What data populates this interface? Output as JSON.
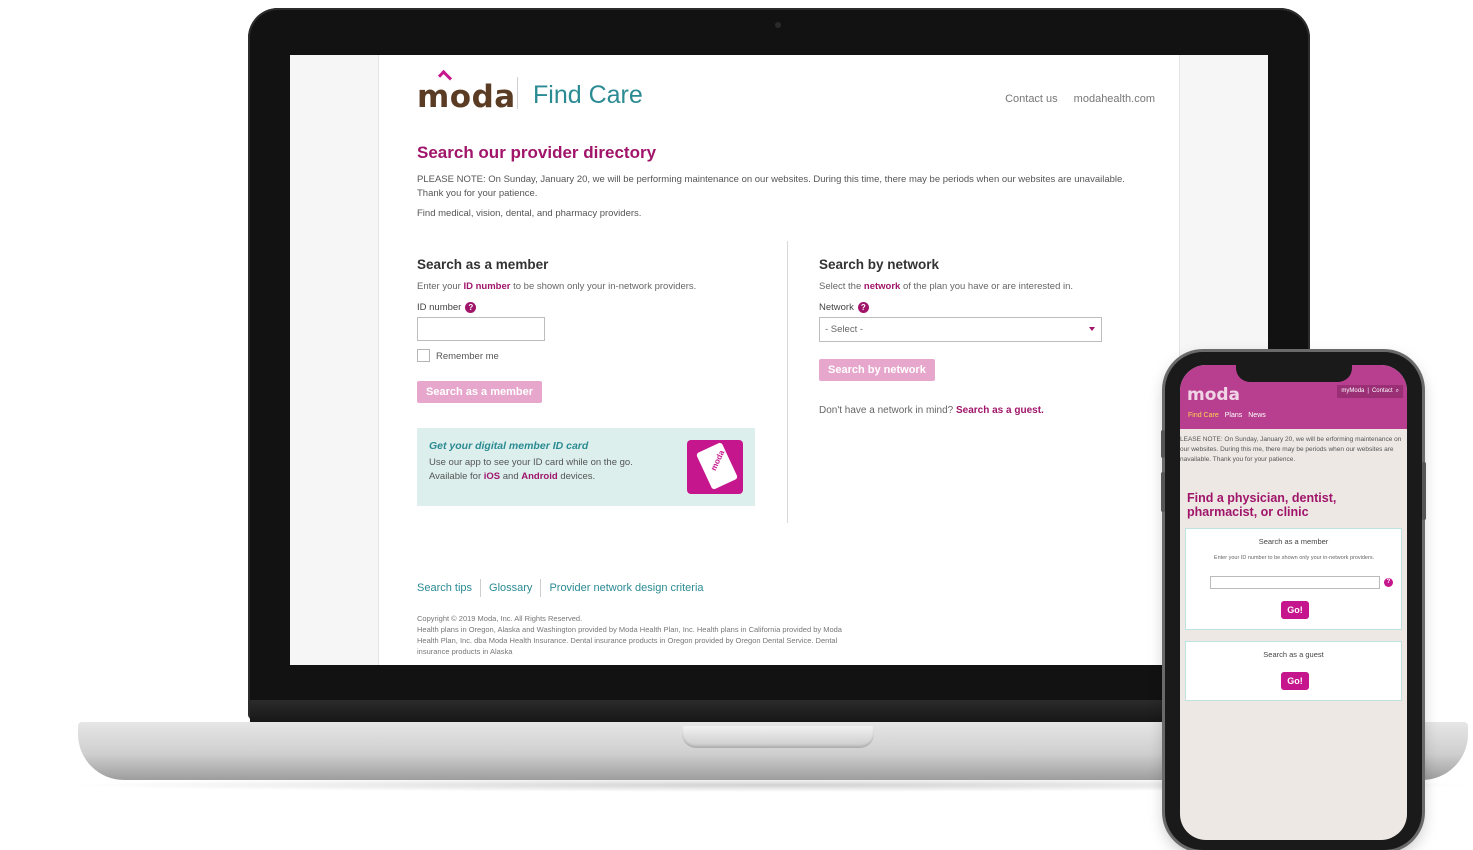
{
  "brand": {
    "logo": "moda",
    "product": "Find Care",
    "colors": {
      "magenta": "#a0156a",
      "teal": "#2b8b92",
      "brown": "#5a3b24",
      "button_pink": "#e7a7cc"
    }
  },
  "header": {
    "links": [
      "Contact us",
      "modahealth.com"
    ]
  },
  "main": {
    "headline": "Search our provider directory",
    "notice": "PLEASE NOTE: On Sunday, January 20, we will be performing maintenance on our websites. During this time, there may be periods when our websites are unavailable. Thank you for your patience.",
    "find_text": "Find medical, vision, dental, and pharmacy providers."
  },
  "member": {
    "title": "Search as a member",
    "desc_before": "Enter your ",
    "desc_link": "ID number",
    "desc_after": " to be shown only your in-network providers.",
    "field_label": "ID number",
    "remember": "Remember me",
    "button": "Search as a member",
    "card_title": "Get your digital member ID card",
    "card_line1": "Use our app to see your ID card while on the go.",
    "card_line2_before": "Available for ",
    "card_ios": "iOS",
    "card_and": " and ",
    "card_android": "Android",
    "card_after": " devices.",
    "card_icon_word": "moda"
  },
  "network": {
    "title": "Search by network",
    "desc_before": "Select the ",
    "desc_link": "network",
    "desc_after": " of the plan you have or are interested in.",
    "field_label": "Network",
    "select_value": "- Select -",
    "button": "Search by network",
    "guest_text": "Don't have a network in mind? ",
    "guest_link": "Search as a guest."
  },
  "footer": {
    "links": [
      "Search tips",
      "Glossary",
      "Provider network design criteria"
    ],
    "copyright": "Copyright © 2019 Moda, Inc. All Rights Reserved.",
    "legal": "Health plans in Oregon, Alaska and Washington provided by Moda Health Plan, Inc. Health plans in California provided by Moda Health Plan, Inc. dba Moda Health Insurance. Dental insurance products in Oregon provided by Oregon Dental Service. Dental insurance products in Alaska"
  },
  "mobile": {
    "logo": "moda",
    "top_links": [
      "myModa",
      "Contact"
    ],
    "nav": [
      "Find Care",
      "Plans",
      "News"
    ],
    "notice": "LEASE NOTE: On Sunday, January 20, we will be erforming maintenance on our websites. During this me, there may be periods when our websites are navailable. Thank you for your patience.",
    "headline": "Find a physician, dentist, pharmacist, or clinic",
    "member_title": "Search as a member",
    "member_desc": "Enter your ID number to be shown only your in-network providers.",
    "go": "Go!",
    "guest_title": "Search as a guest",
    "go2": "Go!"
  }
}
